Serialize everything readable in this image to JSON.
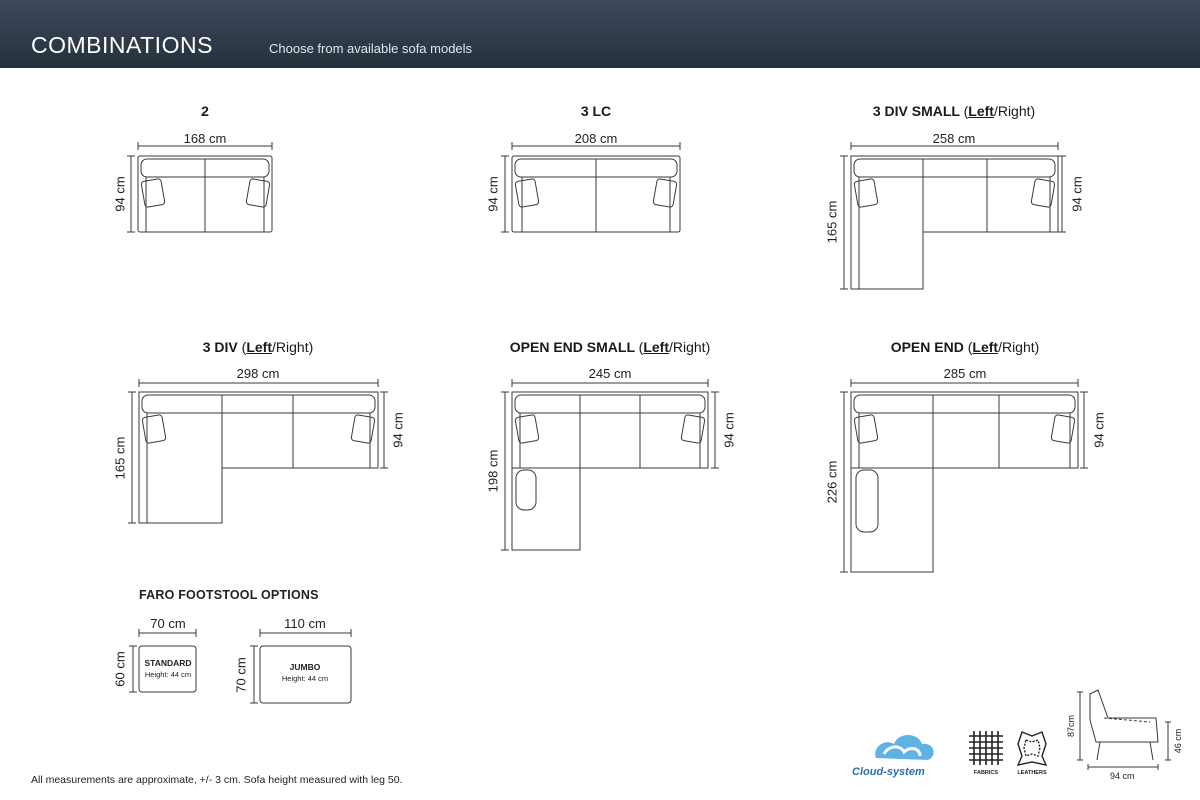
{
  "header": {
    "title": "COMBINATIONS",
    "subtitle": "Choose from available sofa models"
  },
  "models": [
    {
      "title": "2",
      "width": "168 cm",
      "depth": "94 cm"
    },
    {
      "title": "3 LC",
      "width": "208 cm",
      "depth": "94 cm"
    },
    {
      "title": "3 DIV SMALL",
      "left": "Left",
      "right": "/Right)",
      "open": "(",
      "width": "258 cm",
      "depth": "94 cm",
      "long": "165 cm"
    },
    {
      "title": "3 DIV",
      "left": "Left",
      "right": "/Right)",
      "open": "(",
      "width": "298 cm",
      "depth": "94 cm",
      "long": "165 cm"
    },
    {
      "title": "OPEN END SMALL",
      "left": "Left",
      "right": "/Right)",
      "open": "(",
      "width": "245 cm",
      "depth": "94 cm",
      "long": "198 cm"
    },
    {
      "title": "OPEN END",
      "left": "Left",
      "right": "/Right)",
      "open": "(",
      "width": "285 cm",
      "depth": "94 cm",
      "long": "226 cm"
    }
  ],
  "footstool": {
    "title": "FARO FOOTSTOOL OPTIONS",
    "standard": {
      "label": "STANDARD",
      "height": "Height: 44 cm",
      "width": "70 cm",
      "depth": "60 cm"
    },
    "jumbo": {
      "label": "JUMBO",
      "height": "Height: 44 cm",
      "width": "110 cm",
      "depth": "70 cm"
    }
  },
  "footer_note": "All measurements are approximate, +/- 3 cm. Sofa height measured with leg 50.",
  "brand": "Cloud-system",
  "badges": {
    "fabrics": "FABRICS",
    "leathers": "LEATHERS"
  },
  "profile": {
    "height": "87cm",
    "seat_height": "46 cm",
    "depth": "94 cm"
  }
}
